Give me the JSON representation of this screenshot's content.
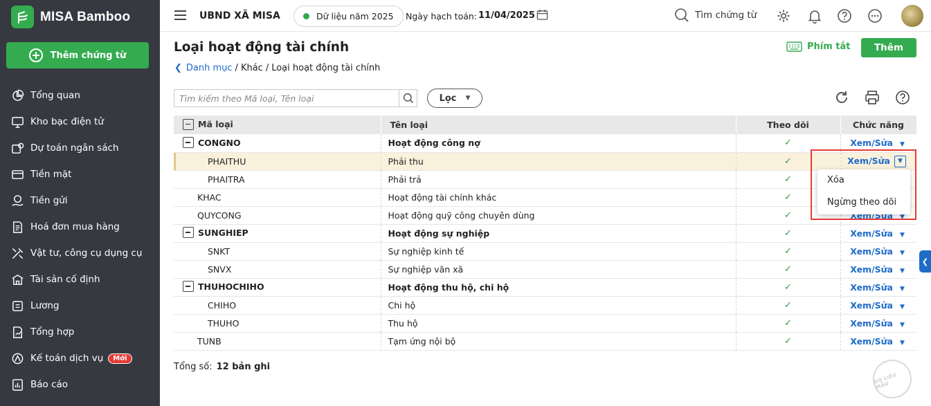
{
  "brand": {
    "name": "MISA Bamboo"
  },
  "sidebar": {
    "new_doc_label": "Thêm chứng từ",
    "items": [
      {
        "label": "Tổng quan",
        "icon": "pie-chart-icon"
      },
      {
        "label": "Kho bạc điện tử",
        "icon": "monitor-icon"
      },
      {
        "label": "Dự toán ngân sách",
        "icon": "budget-icon"
      },
      {
        "label": "Tiền mặt",
        "icon": "cash-icon"
      },
      {
        "label": "Tiền gửi",
        "icon": "deposit-icon"
      },
      {
        "label": "Hoá đơn mua hàng",
        "icon": "invoice-icon"
      },
      {
        "label": "Vật tư, công cụ dụng cụ",
        "icon": "tools-icon"
      },
      {
        "label": "Tài sản cố định",
        "icon": "building-icon"
      },
      {
        "label": "Lương",
        "icon": "salary-icon"
      },
      {
        "label": "Tổng hợp",
        "icon": "summary-icon"
      },
      {
        "label": "Kế toán dịch vụ",
        "icon": "service-icon",
        "badge": "Mới"
      },
      {
        "label": "Báo cáo",
        "icon": "report-icon"
      }
    ]
  },
  "topbar": {
    "org_name": "UBND XÃ MISA",
    "data_year": "Dữ liệu năm 2025",
    "accounting_date_label": "Ngày hạch toán:",
    "accounting_date": "11/04/2025",
    "search_label": "Tìm chứng từ"
  },
  "page": {
    "title": "Loại hoạt động tài chính",
    "breadcrumb": {
      "root": "Danh mục",
      "sep1": "/",
      "mid": "Khác",
      "sep2": "/",
      "current": "Loại hoạt động tài chính"
    },
    "shortcut_label": "Phím tắt",
    "add_label": "Thêm"
  },
  "toolbar": {
    "search_placeholder": "Tìm kiếm theo Mã loại, Tên loại",
    "filter_label": "Lọc"
  },
  "table": {
    "headers": {
      "code": "Mã loại",
      "name": "Tên loại",
      "track": "Theo dõi",
      "action": "Chức năng"
    },
    "rows": [
      {
        "code": "CONGNO",
        "name": "Hoạt động công nợ",
        "level": "group",
        "check": "✓",
        "action": "Xem/Sửa"
      },
      {
        "code": "PHAITHU",
        "name": "Phải thu",
        "level": "child",
        "check": "✓",
        "action": "Xem/Sửa",
        "selected": true
      },
      {
        "code": "PHAITRA",
        "name": "Phải trả",
        "level": "child",
        "check": "✓",
        "action": "Xem/Sửa"
      },
      {
        "code": "KHAC",
        "name": "Hoạt động tài chính khác",
        "level": "leaf",
        "check": "✓",
        "action": "Xem/Sửa"
      },
      {
        "code": "QUYCONG",
        "name": "Hoạt động quỹ công chuyên dùng",
        "level": "leaf",
        "check": "✓",
        "action": "Xem/Sửa"
      },
      {
        "code": "SUNGHIEP",
        "name": "Hoạt động sự nghiệp",
        "level": "group",
        "check": "✓",
        "action": "Xem/Sửa"
      },
      {
        "code": "SNKT",
        "name": "Sự nghiệp kinh tế",
        "level": "child",
        "check": "✓",
        "action": "Xem/Sửa"
      },
      {
        "code": "SNVX",
        "name": "Sự nghiệp văn xã",
        "level": "child",
        "check": "✓",
        "action": "Xem/Sửa"
      },
      {
        "code": "THUHOCHIHO",
        "name": "Hoạt động thu hộ, chi hộ",
        "level": "group",
        "check": "✓",
        "action": "Xem/Sửa"
      },
      {
        "code": "CHIHO",
        "name": "Chi hộ",
        "level": "child",
        "check": "✓",
        "action": "Xem/Sửa"
      },
      {
        "code": "THUHO",
        "name": "Thu hộ",
        "level": "child",
        "check": "✓",
        "action": "Xem/Sửa"
      },
      {
        "code": "TUNB",
        "name": "Tạm ứng nội bộ",
        "level": "leaf",
        "check": "✓",
        "action": "Xem/Sửa"
      }
    ]
  },
  "popup": {
    "items": [
      "Xóa",
      "Ngừng theo dõi"
    ]
  },
  "footer": {
    "total_label": "Tổng số:",
    "total_value": "12 bản ghi"
  },
  "watermark": "DỮ LIỆU MẪU",
  "colors": {
    "brand_green": "#35ab4f",
    "sidebar_bg": "#363a40",
    "link_blue": "#1e6bc8",
    "highlight_red": "#e53935",
    "selected_row": "#faf1dc"
  }
}
